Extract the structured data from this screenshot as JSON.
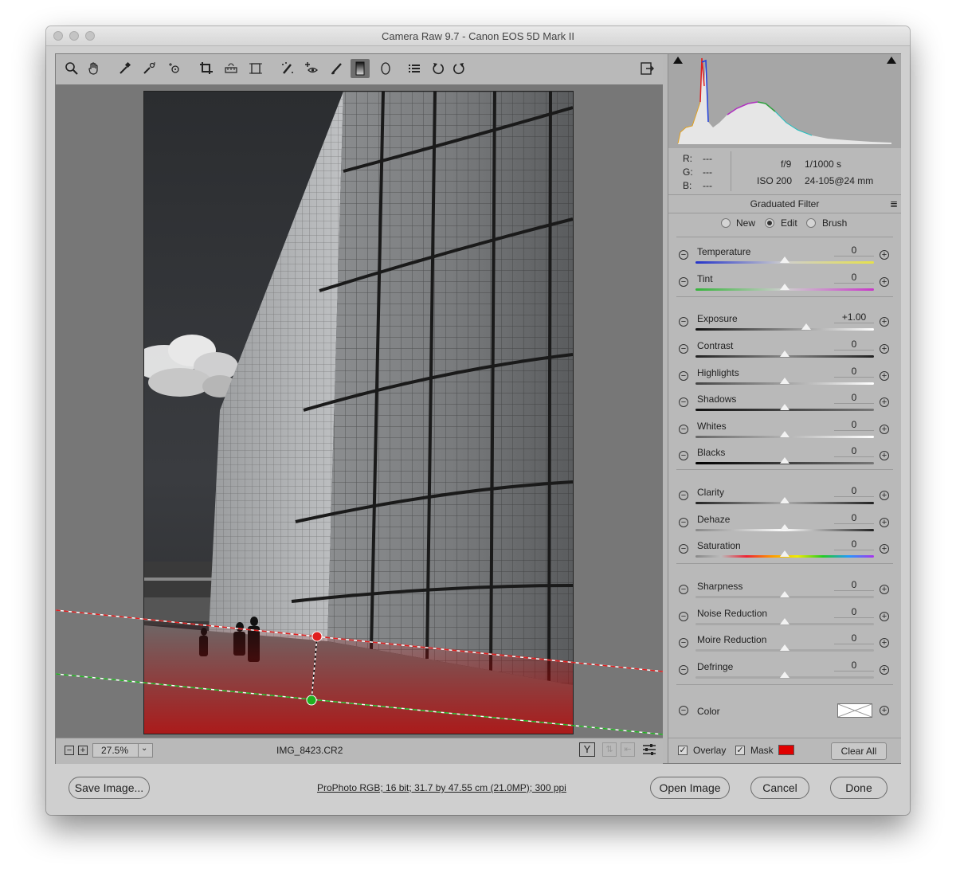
{
  "window": {
    "title": "Camera Raw 9.7  -  Canon EOS 5D Mark II"
  },
  "toolbar": {
    "tools": [
      "zoom-icon",
      "hand-icon",
      "white-balance-icon",
      "color-sampler-icon",
      "targeted-adjustment-icon",
      "crop-icon",
      "straighten-icon",
      "transform-icon",
      "spot-removal-icon",
      "red-eye-icon",
      "adjustment-brush-icon",
      "graduated-filter-icon",
      "radial-filter-icon",
      "preferences-icon",
      "rotate-left-icon",
      "rotate-right-icon"
    ],
    "fullscreen_icon": "fullscreen-icon"
  },
  "statusbar": {
    "zoom_value": "27.5%",
    "filename": "IMG_8423.CR2"
  },
  "info": {
    "r_label": "R:",
    "g_label": "G:",
    "b_label": "B:",
    "r_value": "---",
    "g_value": "---",
    "b_value": "---",
    "aperture": "f/9",
    "shutter": "1/1000 s",
    "iso": "ISO 200",
    "lens": "24-105@24 mm"
  },
  "panel": {
    "title": "Graduated Filter",
    "modes": [
      {
        "label": "New",
        "selected": false
      },
      {
        "label": "Edit",
        "selected": true
      },
      {
        "label": "Brush",
        "selected": false
      }
    ],
    "sliders": [
      {
        "label": "Temperature",
        "value": "0",
        "level": 0.5
      },
      {
        "label": "Tint",
        "value": "0",
        "level": 0.5
      },
      {
        "label": "Exposure",
        "value": "+1.00",
        "level": 0.62
      },
      {
        "label": "Contrast",
        "value": "0",
        "level": 0.5
      },
      {
        "label": "Highlights",
        "value": "0",
        "level": 0.5
      },
      {
        "label": "Shadows",
        "value": "0",
        "level": 0.5
      },
      {
        "label": "Whites",
        "value": "0",
        "level": 0.5
      },
      {
        "label": "Blacks",
        "value": "0",
        "level": 0.5
      },
      {
        "label": "Clarity",
        "value": "0",
        "level": 0.5
      },
      {
        "label": "Dehaze",
        "value": "0",
        "level": 0.5
      },
      {
        "label": "Saturation",
        "value": "0",
        "level": 0.5
      },
      {
        "label": "Sharpness",
        "value": "0",
        "level": 0.5
      },
      {
        "label": "Noise Reduction",
        "value": "0",
        "level": 0.5
      },
      {
        "label": "Moire Reduction",
        "value": "0",
        "level": 0.5
      },
      {
        "label": "Defringe",
        "value": "0",
        "level": 0.5
      }
    ],
    "color_label": "Color",
    "overlay_label": "Overlay",
    "overlay_checked": true,
    "mask_label": "Mask",
    "mask_checked": true,
    "mask_color": "#e00000",
    "clear_all_label": "Clear All"
  },
  "footer": {
    "save_label": "Save Image...",
    "workflow_link": "ProPhoto RGB; 16 bit; 31.7 by 47.55 cm (21.0MP); 300 ppi",
    "open_label": "Open Image",
    "cancel_label": "Cancel",
    "done_label": "Done"
  },
  "colors": {
    "mask_red": "#e00000",
    "start_pin": "#e02020",
    "end_pin": "#20b020"
  }
}
